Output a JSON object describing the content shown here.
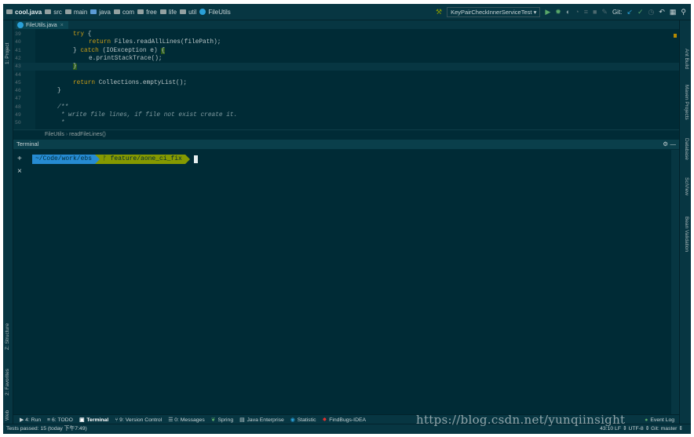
{
  "nav": {
    "crumbs": [
      "cool.java",
      "src",
      "main",
      "java",
      "com",
      "free",
      "life",
      "util",
      "FileUtils"
    ],
    "run_config": "KeyPairCheckInnerServiceTest",
    "git_label": "Git:"
  },
  "left_strip": {
    "project": "1: Project",
    "structure": "Z: Structure",
    "favorites": "2: Favorites",
    "web": "Web"
  },
  "right_strip": {
    "ant": "Ant Build",
    "maven": "Maven Projects",
    "database": "Database",
    "sciview": "SciView",
    "bean": "Bean Validation"
  },
  "editor": {
    "tab_label": "FileUtils.java",
    "lines": [
      {
        "num": "39",
        "text": "try {"
      },
      {
        "num": "40",
        "text": "    return Files.readAllLines(filePath);"
      },
      {
        "num": "41",
        "text": "} catch (IOException e) {"
      },
      {
        "num": "42",
        "text": "    e.printStackTrace();"
      },
      {
        "num": "43",
        "text": "}"
      },
      {
        "num": "44",
        "text": ""
      },
      {
        "num": "45",
        "text": "return Collections.emptyList();"
      },
      {
        "num": "46",
        "text": "}"
      },
      {
        "num": "47",
        "text": ""
      },
      {
        "num": "48",
        "text": "/**"
      },
      {
        "num": "49",
        "text": " * write file lines, if file not exist create it."
      },
      {
        "num": "50",
        "text": " *"
      }
    ],
    "breadcrumb": [
      "FileUtils",
      "readFileLines()"
    ]
  },
  "terminal": {
    "title": "Terminal",
    "add": "+",
    "close": "×",
    "path": "~/Code/work/ebs",
    "branch": "ᚠ feature/aone_ci_fix"
  },
  "bottom_tabs": [
    "▶ 4: Run",
    "≡ 6: TODO",
    "Terminal",
    "⑂ 9: Version Control",
    "☰ 0: Messages",
    "Spring",
    "Java Enterprise",
    "Statistic",
    "FindBugs-IDEA",
    "Event Log"
  ],
  "status": {
    "left": "Tests passed: 15 (today 下午7:49)",
    "right": "43:10   LF ⇕   UTF-8 ⇕   Git: master ⇕"
  },
  "watermark": "https://blog.csdn.net/yunqiinsight",
  "colors": {
    "background": "#002b36",
    "prompt_path": "#268bd2",
    "prompt_branch": "#859900",
    "keyword": "#cb9e16"
  }
}
